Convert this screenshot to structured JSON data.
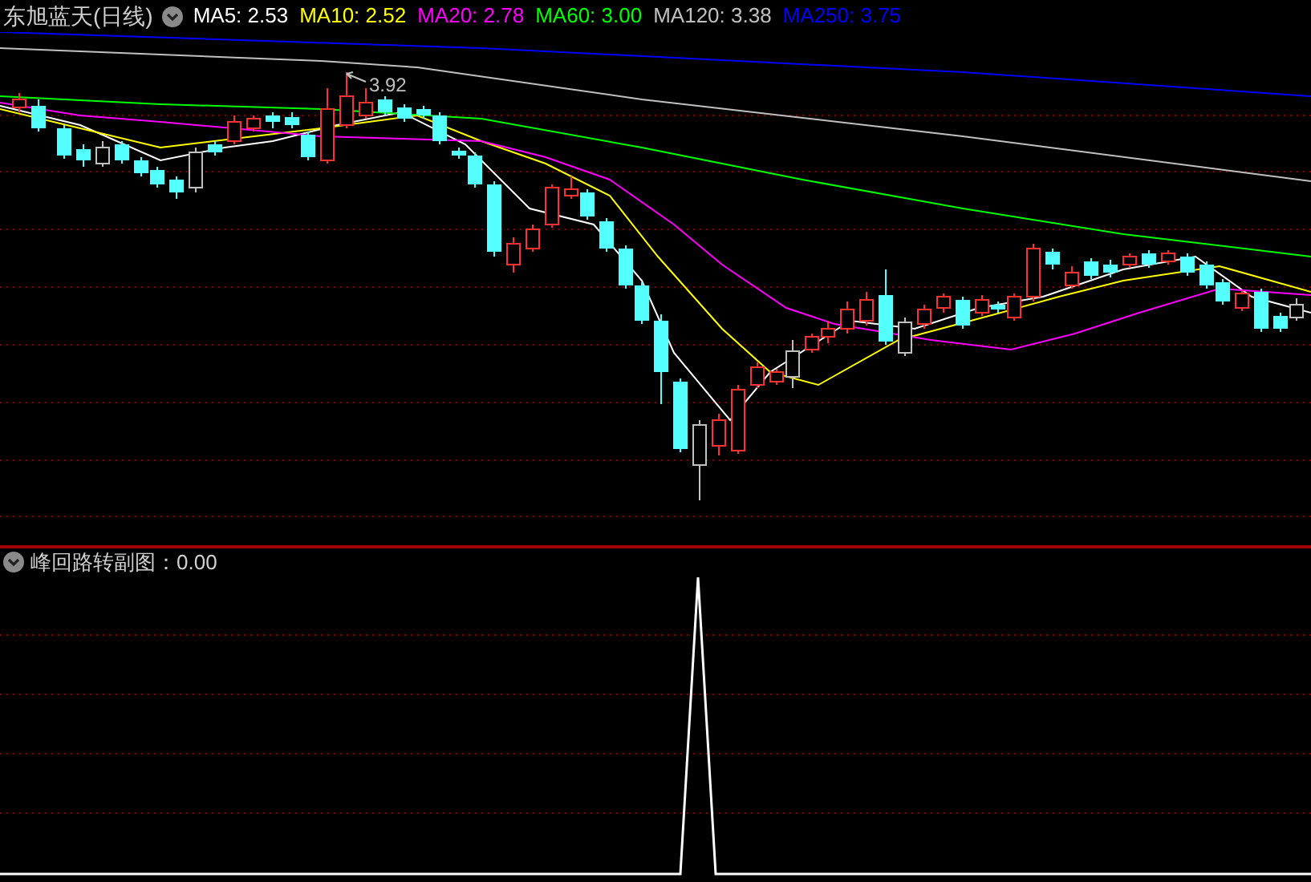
{
  "header": {
    "title": "东旭蓝天(日线)",
    "indicators": [
      {
        "label": "MA5: 2.53",
        "color": "#ffffff"
      },
      {
        "label": "MA10: 2.52",
        "color": "#ffff00"
      },
      {
        "label": "MA20: 2.78",
        "color": "#ff00ff"
      },
      {
        "label": "MA60: 3.00",
        "color": "#00ff00"
      },
      {
        "label": "MA120: 3.38",
        "color": "#c0c0c0"
      },
      {
        "label": "MA250: 3.75",
        "color": "#0000ff"
      }
    ]
  },
  "main_chart": {
    "high_label": "3.92"
  },
  "sub_chart": {
    "title": "峰回路转副图：0.00"
  }
}
